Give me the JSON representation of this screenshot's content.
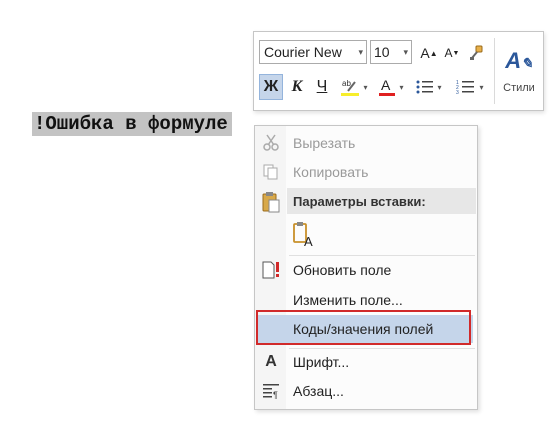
{
  "document": {
    "field_text": "!Ошибка в формуле"
  },
  "minibar": {
    "font_name": "Courier New",
    "font_size": "10",
    "grow_font": "A",
    "shrink_font": "A",
    "bold": "Ж",
    "italic": "К",
    "underline": "Ч",
    "styles_label": "Стили",
    "highlight_color": "#f7ee2b",
    "font_color": "#e02020",
    "accent": "#2b579a"
  },
  "context_menu": {
    "items": {
      "cut": {
        "label": "Вырезать",
        "icon": "scissors-icon",
        "disabled": true
      },
      "copy": {
        "label": "Копировать",
        "icon": "copy-icon",
        "disabled": true
      },
      "paste_header": "Параметры вставки:",
      "paste_option": {
        "icon": "paste-text-only-icon",
        "glyph": "A"
      },
      "update_field": {
        "label": "Обновить поле",
        "icon": "update-field-icon"
      },
      "edit_field": {
        "label": "Изменить поле..."
      },
      "toggle_codes": {
        "label": "Коды/значения полей",
        "selected": true
      },
      "font": {
        "label": "Шрифт...",
        "icon": "font-icon",
        "glyph": "A"
      },
      "paragraph": {
        "label": "Абзац...",
        "icon": "paragraph-icon"
      }
    }
  },
  "highlight_color": "#d12a2a"
}
